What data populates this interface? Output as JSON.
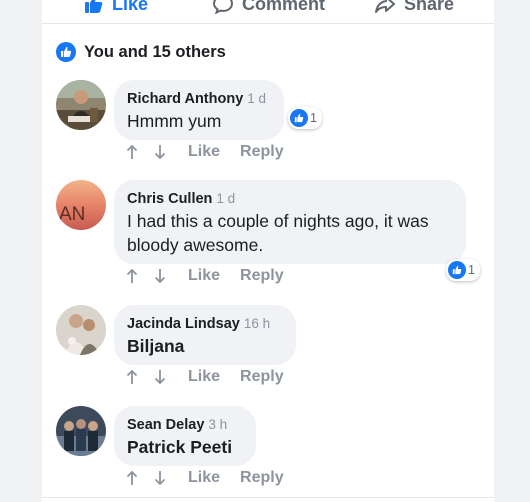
{
  "post_actions": {
    "like_label": "Like",
    "comment_label": "Comment",
    "share_label": "Share"
  },
  "reactions_summary": {
    "text": "You and 15 others",
    "icon": "thumbs-up-icon"
  },
  "comments": [
    {
      "name": "Richard Anthony",
      "time": "1 d",
      "text": "Hmmm yum",
      "bold_text": false,
      "reaction_count": "1",
      "avatar": "avatar-photo"
    },
    {
      "name": "Chris Cullen",
      "time": "1 d",
      "text": "I had this a couple of nights ago, it was bloody awesome.",
      "bold_text": false,
      "reaction_count": "1",
      "avatar": "avatar-logo",
      "avatar_text": "AN"
    },
    {
      "name": "Jacinda Lindsay",
      "time": "16 h",
      "text": "Biljana",
      "bold_text": true,
      "avatar": "avatar-photo"
    },
    {
      "name": "Sean Delay",
      "time": "3 h",
      "text": "Patrick Peeti",
      "bold_text": true,
      "avatar": "avatar-photo"
    }
  ],
  "comment_actions": {
    "like_label": "Like",
    "reply_label": "Reply"
  },
  "colors": {
    "brand_blue": "#1877f2",
    "bubble_bg": "#f0f2f5",
    "meta_gray": "#8d949e"
  }
}
